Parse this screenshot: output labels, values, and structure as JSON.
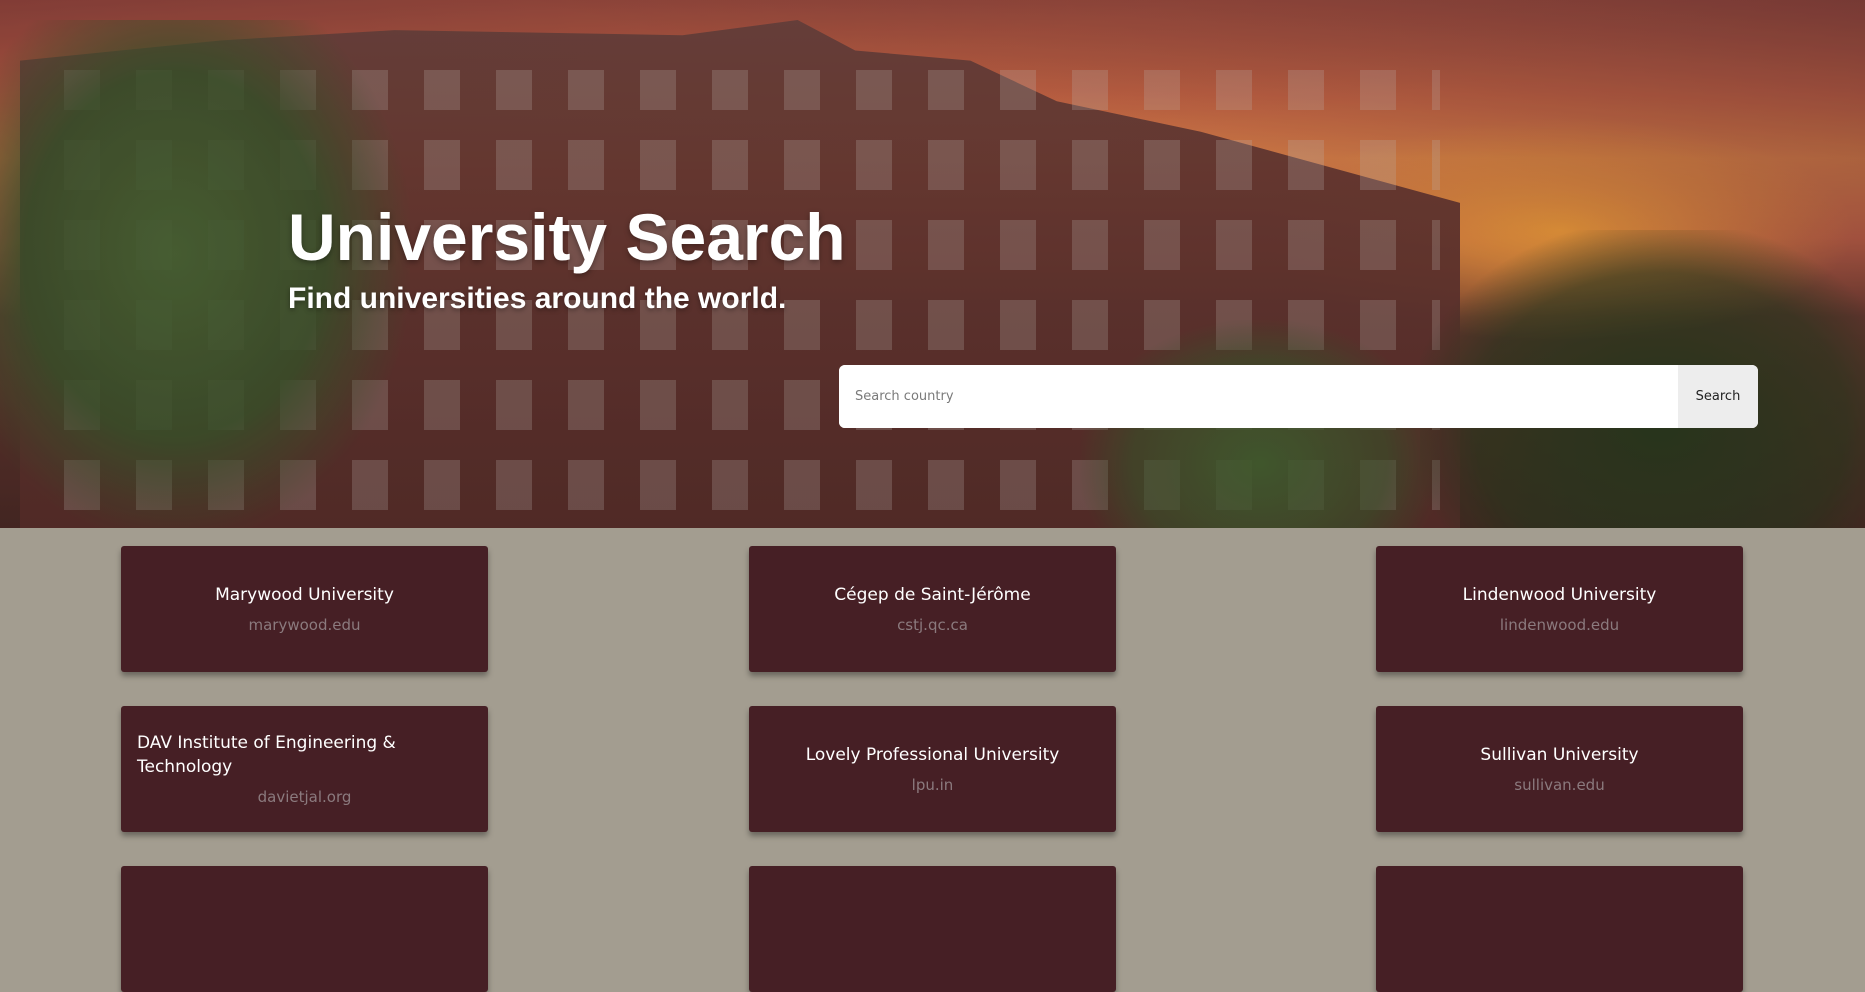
{
  "hero": {
    "title": "University Search",
    "subtitle": "Find universities around the world."
  },
  "search": {
    "placeholder": "Search country",
    "value": "",
    "button_label": "Search"
  },
  "results": [
    {
      "name": "Marywood University",
      "domain": "marywood.edu"
    },
    {
      "name": "Cégep de Saint-Jérôme",
      "domain": "cstj.qc.ca"
    },
    {
      "name": "Lindenwood University",
      "domain": "lindenwood.edu"
    },
    {
      "name": "DAV Institute of Engineering & Technology",
      "domain": "davietjal.org"
    },
    {
      "name": "Lovely Professional University",
      "domain": "lpu.in"
    },
    {
      "name": "Sullivan University",
      "domain": "sullivan.edu"
    },
    {
      "name": "",
      "domain": ""
    },
    {
      "name": "",
      "domain": ""
    },
    {
      "name": "",
      "domain": ""
    }
  ],
  "colors": {
    "page_background": "#a39d90",
    "card_background": "#461f25",
    "card_title": "#ffffff",
    "card_domain": "#8b7a7e",
    "search_button_bg": "#ededed"
  }
}
